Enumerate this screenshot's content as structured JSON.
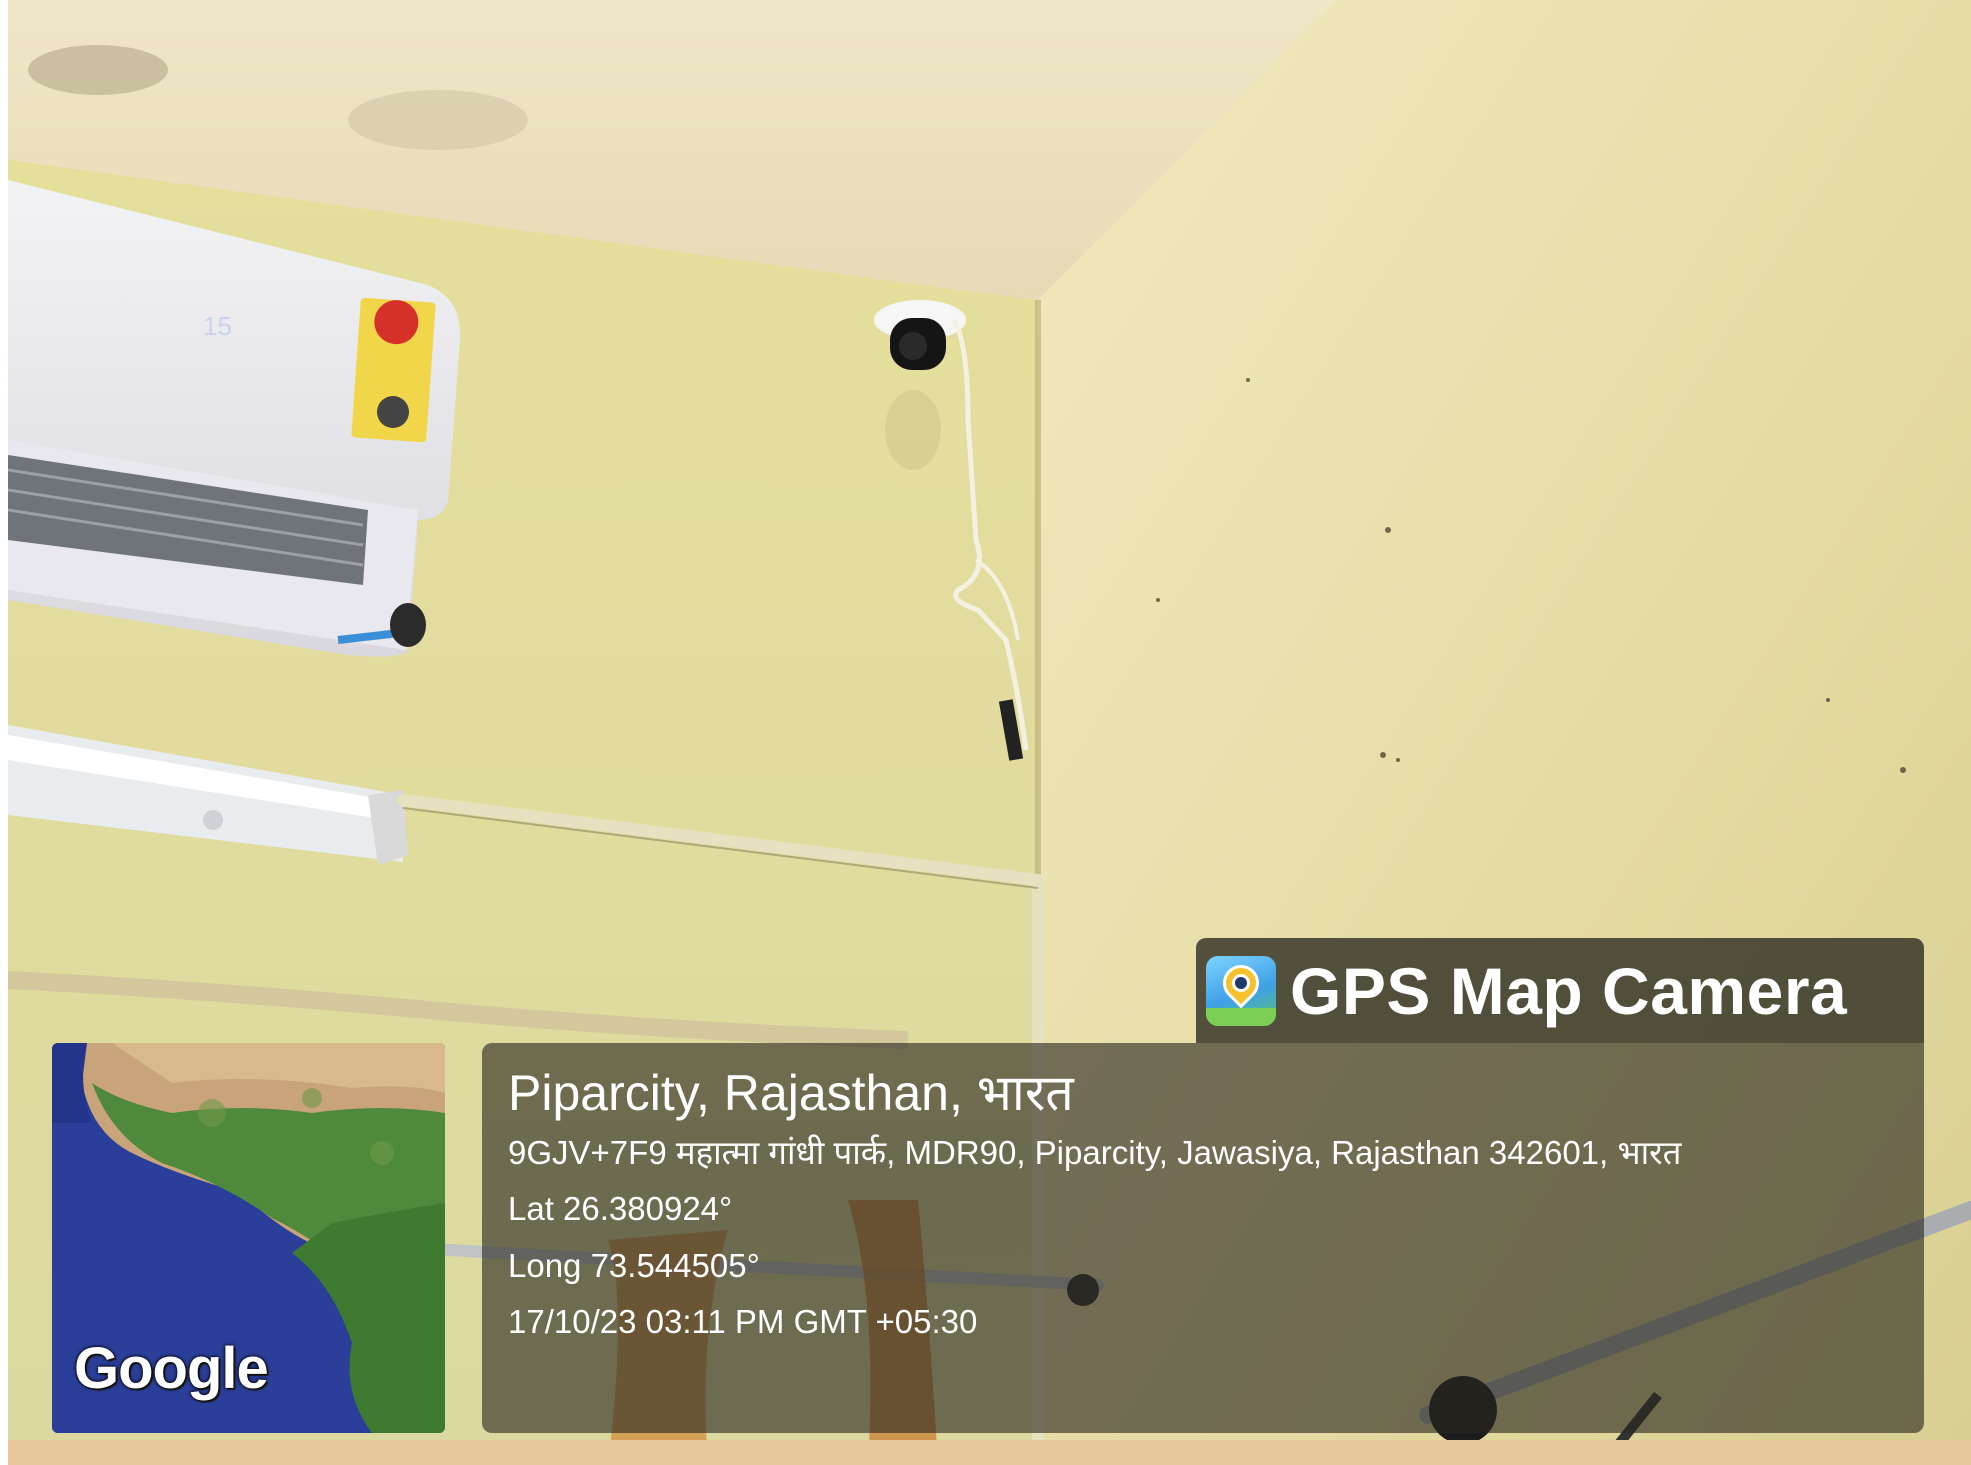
{
  "watermark": {
    "app_name": "GPS Map Camera",
    "app_icon": "gps-map-camera-icon",
    "location_title": "Piparcity, Rajasthan, भारत",
    "address": "9GJV+7F9 महात्मा गांधी पार्क, MDR90, Piparcity, Jawasiya, Rajasthan 342601, भारत",
    "latitude": "Lat 26.380924°",
    "longitude": "Long 73.544505°",
    "datetime": "17/10/23 03:11 PM GMT +05:30"
  },
  "map": {
    "provider_logo": "Google",
    "type": "satellite"
  },
  "colors": {
    "panel_background": "#28261e",
    "panel_text": "#ffffff",
    "wall": "#e3dca3",
    "ocean": "#2b3f9a",
    "land_green": "#4f8a3c",
    "land_desert": "#c9a47a"
  }
}
